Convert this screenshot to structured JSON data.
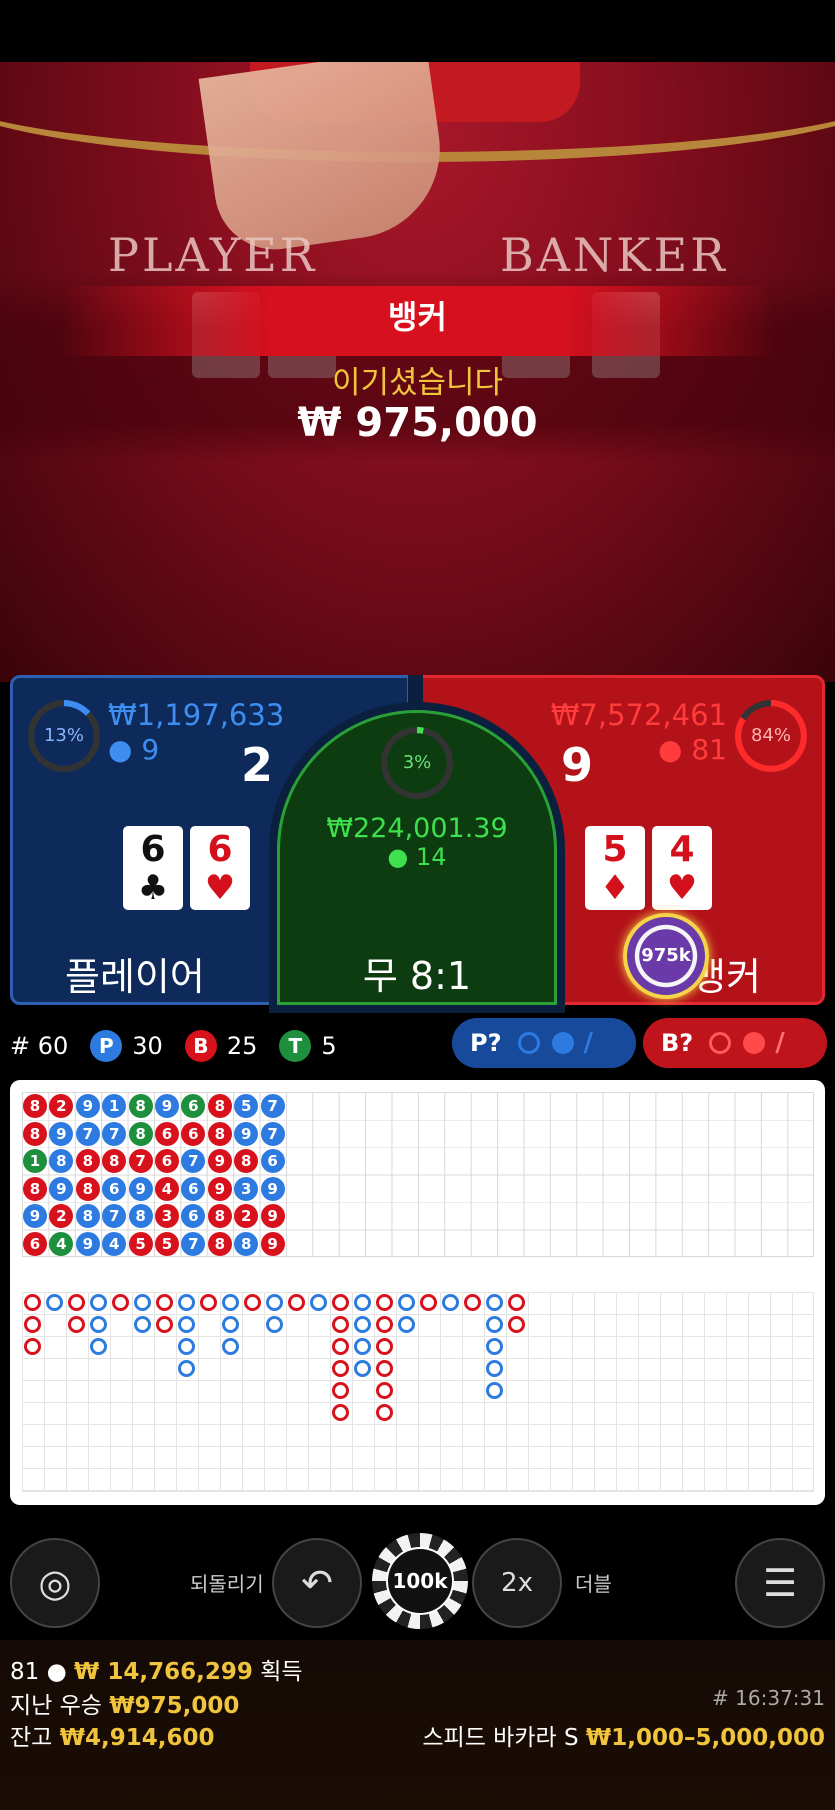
{
  "video": {
    "table_word_player": "PLAYER",
    "table_word_banker": "BANKER",
    "result": {
      "winner": "뱅커",
      "message": "이기셨습니다",
      "amount": "₩ 975,000"
    }
  },
  "player": {
    "percent": "13%",
    "percent_value": 0.13,
    "amount": "₩1,197,633",
    "players": "9",
    "score": "2",
    "label": "플레이어",
    "cards": [
      {
        "rank": "6",
        "suit": "♣",
        "color": "#111111"
      },
      {
        "rank": "6",
        "suit": "♥",
        "color": "#d4101c"
      }
    ]
  },
  "tie": {
    "percent": "3%",
    "percent_value": 0.03,
    "amount": "₩224,001.39",
    "players": "14",
    "label": "무 8:1"
  },
  "banker": {
    "percent": "84%",
    "percent_value": 0.84,
    "amount": "₩7,572,461",
    "players": "81",
    "score": "9",
    "label": "뱅커",
    "bet_chip": "975k",
    "cards": [
      {
        "rank": "5",
        "suit": "♦",
        "color": "#d4101c"
      },
      {
        "rank": "4",
        "suit": "♥",
        "color": "#d4101c"
      }
    ]
  },
  "stats": {
    "round": "# 60",
    "p_letter": "P",
    "p_count": "30",
    "b_letter": "B",
    "b_count": "25",
    "t_letter": "T",
    "t_count": "5"
  },
  "predict": {
    "player_label": "P?",
    "banker_label": "B?"
  },
  "colors": {
    "player": "#2d7be0",
    "banker": "#d8121c",
    "tie": "#1e8f3c",
    "gold": "#f0c43c"
  },
  "bead_road": [
    [
      "8",
      "2",
      "9",
      "1",
      "8",
      "9",
      "6",
      "8",
      "5",
      "7"
    ],
    [
      "8",
      "9",
      "7",
      "7",
      "8",
      "6",
      "6",
      "8",
      "9",
      "7"
    ],
    [
      "1",
      "8",
      "8",
      "8",
      "7",
      "6",
      "7",
      "9",
      "8",
      "6"
    ],
    [
      "8",
      "9",
      "8",
      "6",
      "9",
      "4",
      "6",
      "9",
      "3",
      "9"
    ],
    [
      "9",
      "2",
      "8",
      "7",
      "8",
      "3",
      "6",
      "8",
      "2",
      "9"
    ],
    [
      "6",
      "4",
      "9",
      "4",
      "5",
      "5",
      "7",
      "8",
      "8",
      "9"
    ]
  ],
  "bead_colors": [
    [
      "B",
      "B",
      "P",
      "P",
      "T",
      "P",
      "T",
      "B",
      "P",
      "P"
    ],
    [
      "B",
      "P",
      "P",
      "P",
      "T",
      "B",
      "B",
      "B",
      "P",
      "P"
    ],
    [
      "T",
      "P",
      "B",
      "B",
      "B",
      "B",
      "P",
      "B",
      "B",
      "P"
    ],
    [
      "B",
      "P",
      "B",
      "P",
      "P",
      "B",
      "P",
      "B",
      "P",
      "P"
    ],
    [
      "P",
      "B",
      "P",
      "P",
      "P",
      "B",
      "P",
      "B",
      "B",
      "B"
    ],
    [
      "B",
      "T",
      "P",
      "P",
      "B",
      "B",
      "P",
      "B",
      "P",
      "B"
    ]
  ],
  "controls": {
    "undo_label": "되돌리기",
    "double_label": "더블",
    "chip_value": "100k",
    "double_value": "2x"
  },
  "footer": {
    "online_count": "81",
    "win_amount": "₩ 14,766,299",
    "win_suffix": "획득",
    "last_win_label": "지난 우승",
    "last_win_amount": "₩975,000",
    "balance_label": "잔고",
    "balance_amount": "₩4,914,600",
    "round_time": "# 16:37:31",
    "game_name": "스피드 바카라 S",
    "limits": "₩1,000–5,000,000"
  }
}
